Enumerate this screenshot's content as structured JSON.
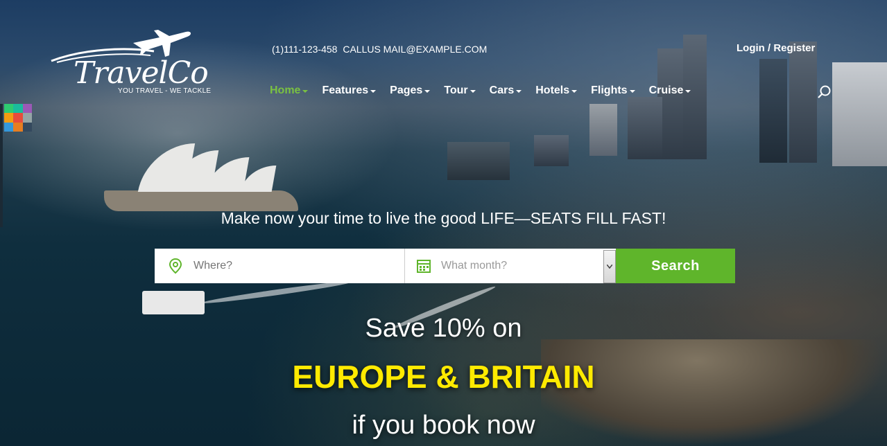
{
  "brand": {
    "name": "TravelCo",
    "tagline": "YOU TRAVEL - WE TACKLE"
  },
  "header": {
    "phone": "(1)111-123-458",
    "email_text": "CALLUS MAIL@EXAMPLE.COM",
    "login": "Login",
    "separator": "/",
    "register": "Register"
  },
  "nav": {
    "items": [
      {
        "label": "Home",
        "active": true
      },
      {
        "label": "Features"
      },
      {
        "label": "Pages"
      },
      {
        "label": "Tour"
      },
      {
        "label": "Cars"
      },
      {
        "label": "Hotels"
      },
      {
        "label": "Flights"
      },
      {
        "label": "Cruise"
      }
    ]
  },
  "hero": {
    "tagline": "Make now your time to live the good LIFE—SEATS FILL FAST!",
    "promo_line1": "Save 10% on",
    "promo_line2": "EUROPE & BRITAIN",
    "promo_line3": "if you book now"
  },
  "search": {
    "where_placeholder": "Where?",
    "month_placeholder": "What month?",
    "button_label": "Search"
  },
  "colors": {
    "accent_green": "#5fb52b",
    "active_nav": "#7ac142",
    "promo_yellow": "#ffea00"
  },
  "icons": [
    "plane-icon",
    "map-pin-icon",
    "calendar-icon",
    "search-icon",
    "chevron-down-icon"
  ]
}
